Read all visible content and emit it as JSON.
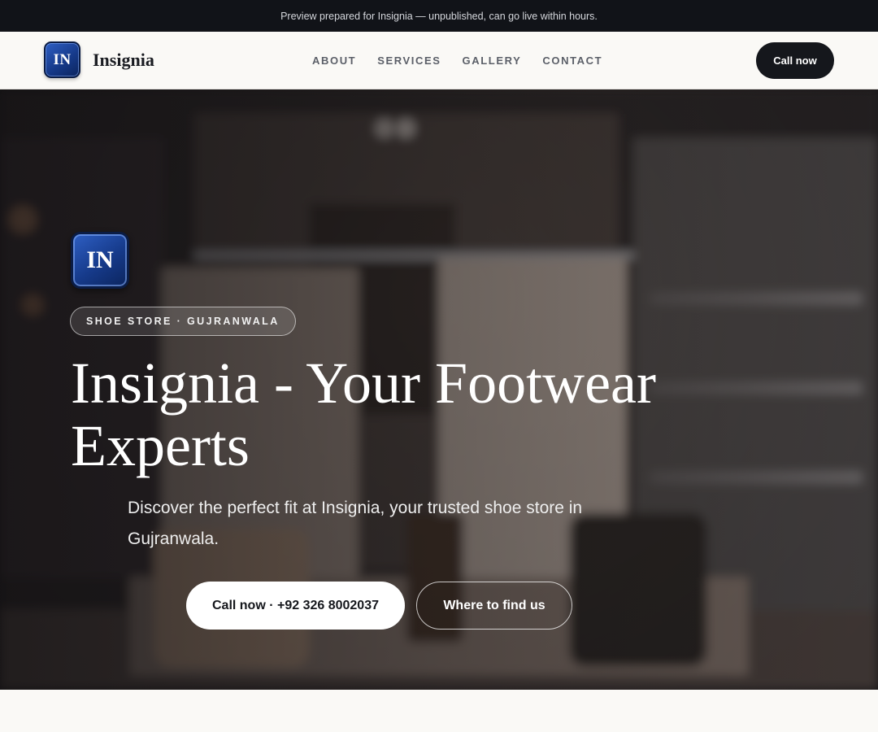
{
  "banner": {
    "text": "Preview prepared for Insignia — unpublished, can go live within hours."
  },
  "header": {
    "logo_text": "IN",
    "brand_name": "Insignia",
    "nav": [
      {
        "label": "ABOUT"
      },
      {
        "label": "SERVICES"
      },
      {
        "label": "GALLERY"
      },
      {
        "label": "CONTACT"
      }
    ],
    "cta_label": "Call now"
  },
  "hero": {
    "logo_text": "IN",
    "tag": "SHOE STORE · GUJRANWALA",
    "title": "Insignia - Your Footwear Experts",
    "subtitle": "Discover the perfect fit at Insignia, your trusted shoe store in Gujranwala.",
    "primary_button": "Call now · +92 326 8002037",
    "secondary_button": "Where to find us"
  },
  "colors": {
    "banner_bg": "#111318",
    "header_bg": "#faf9f6",
    "cta_bg": "#15171c",
    "logo_blue": "#163a8a"
  }
}
